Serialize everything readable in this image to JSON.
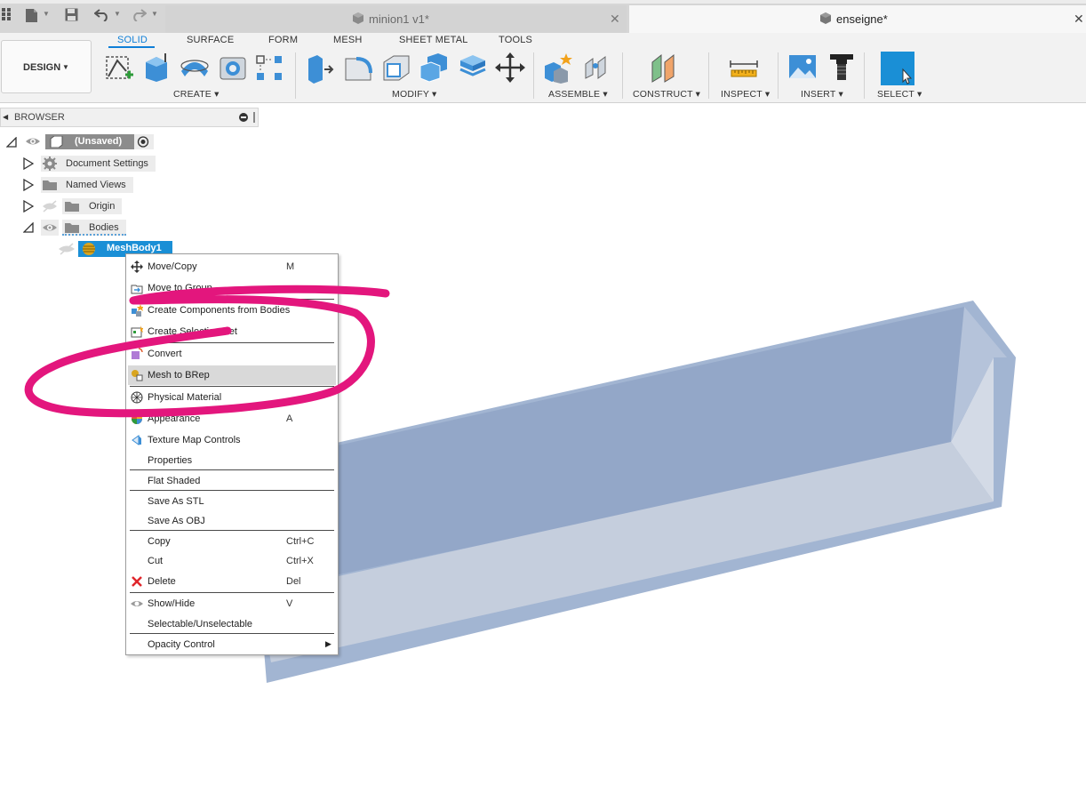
{
  "tabs": [
    {
      "label": "minion1 v1*",
      "active": false
    },
    {
      "label": "enseigne*",
      "active": true
    }
  ],
  "workspace": {
    "label": "DESIGN"
  },
  "ribbon_tabs": [
    "SOLID",
    "SURFACE",
    "FORM",
    "MESH",
    "SHEET METAL",
    "TOOLS"
  ],
  "groups": {
    "create": "CREATE",
    "modify": "MODIFY",
    "assemble": "ASSEMBLE",
    "construct": "CONSTRUCT",
    "inspect": "INSPECT",
    "insert": "INSERT",
    "select": "SELECT"
  },
  "browser": {
    "title": "BROWSER",
    "root": "(Unsaved)",
    "items": [
      "Document Settings",
      "Named Views",
      "Origin",
      "Bodies"
    ],
    "selected_body": "MeshBody1"
  },
  "menu": [
    {
      "label": "Move/Copy",
      "shortcut": "M"
    },
    {
      "label": "Move to Group",
      "shortcut": ""
    },
    {
      "label": "Create Components from Bodies",
      "shortcut": ""
    },
    {
      "label": "Create Selection Set",
      "shortcut": ""
    },
    {
      "label": "Convert",
      "shortcut": ""
    },
    {
      "label": "Mesh to BRep",
      "shortcut": ""
    },
    {
      "label": "Physical Material",
      "shortcut": ""
    },
    {
      "label": "Appearance",
      "shortcut": "A"
    },
    {
      "label": "Texture Map Controls",
      "shortcut": ""
    },
    {
      "label": "Properties",
      "shortcut": ""
    },
    {
      "label": "Flat Shaded",
      "shortcut": ""
    },
    {
      "label": "Save As STL",
      "shortcut": ""
    },
    {
      "label": "Save As OBJ",
      "shortcut": ""
    },
    {
      "label": "Copy",
      "shortcut": "Ctrl+C"
    },
    {
      "label": "Cut",
      "shortcut": "Ctrl+X"
    },
    {
      "label": "Delete",
      "shortcut": "Del"
    },
    {
      "label": "Show/Hide",
      "shortcut": "V"
    },
    {
      "label": "Selectable/Unselectable",
      "shortcut": ""
    },
    {
      "label": "Opacity Control",
      "shortcut": ""
    }
  ],
  "colors": {
    "accent": "#0f7fd7",
    "annotation": "#e3167d",
    "model": "#9fb1cf",
    "selection": "#1a8fd6"
  }
}
